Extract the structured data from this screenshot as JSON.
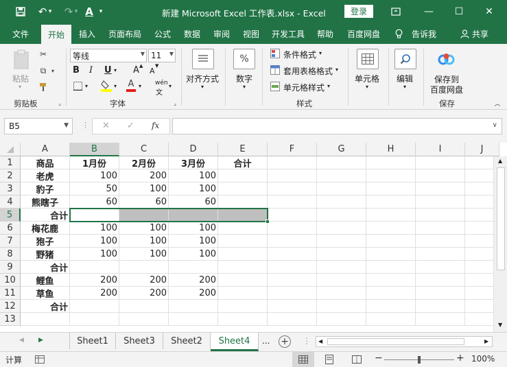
{
  "titlebar": {
    "title": "新建 Microsoft Excel 工作表.xlsx  -  Excel",
    "login": "登录",
    "bg_color": "#217346"
  },
  "menu": {
    "tabs": [
      "文件",
      "开始",
      "插入",
      "页面布局",
      "公式",
      "数据",
      "审阅",
      "视图",
      "开发工具",
      "帮助",
      "百度网盘",
      "告诉我",
      "共享"
    ],
    "active": "开始"
  },
  "ribbon": {
    "clipboard": {
      "paste": "粘贴",
      "label": "剪贴板"
    },
    "font": {
      "name": "等线",
      "size": "11",
      "bold": "B",
      "italic": "I",
      "underline": "U",
      "grow": "A",
      "shrink": "A",
      "color_a": "A",
      "wen": "wén",
      "label": "字体"
    },
    "alignment": {
      "label": "对齐方式"
    },
    "number": {
      "label": "数字",
      "symbol": "%"
    },
    "styles": {
      "conditional": "条件格式",
      "table": "套用表格格式",
      "cell": "单元格样式",
      "label": "样式"
    },
    "cells": {
      "label": "单元格"
    },
    "editing": {
      "label": "编辑"
    },
    "save": {
      "line1": "保存到",
      "line2": "百度网盘",
      "label": "保存"
    }
  },
  "formula_bar": {
    "name_box": "B5",
    "cancel": "✕",
    "enter": "✓",
    "fx": "fx",
    "value": ""
  },
  "grid": {
    "columns": [
      "A",
      "B",
      "C",
      "D",
      "E",
      "F",
      "G",
      "H",
      "I",
      "J"
    ],
    "rows": [
      "1",
      "2",
      "3",
      "4",
      "5",
      "6",
      "7",
      "8",
      "9",
      "10",
      "11",
      "12",
      "13"
    ],
    "selected_cell": "B5",
    "cells": [
      [
        "商品",
        "1月份",
        "2月份",
        "3月份",
        "合计"
      ],
      [
        "老虎",
        "100",
        "200",
        "100",
        ""
      ],
      [
        "豹子",
        "50",
        "100",
        "100",
        ""
      ],
      [
        "熊瞎子",
        "60",
        "60",
        "60",
        ""
      ],
      [
        "合计",
        "",
        "",
        "",
        ""
      ],
      [
        "梅花鹿",
        "100",
        "100",
        "100",
        ""
      ],
      [
        "狍子",
        "100",
        "100",
        "100",
        ""
      ],
      [
        "野猪",
        "100",
        "100",
        "100",
        ""
      ],
      [
        "合计",
        "",
        "",
        "",
        ""
      ],
      [
        "鲤鱼",
        "200",
        "200",
        "200",
        ""
      ],
      [
        "草鱼",
        "200",
        "200",
        "200",
        ""
      ],
      [
        "合计",
        "",
        "",
        "",
        ""
      ],
      [
        "",
        "",
        "",
        "",
        ""
      ]
    ]
  },
  "sheets": {
    "tabs": [
      "Sheet1",
      "Sheet3",
      "Sheet2",
      "Sheet4"
    ],
    "active": "Sheet4",
    "more": "...",
    "add": "+"
  },
  "status": {
    "mode": "计算",
    "zoom": "100%",
    "zoom_minus": "−",
    "zoom_plus": "+"
  }
}
